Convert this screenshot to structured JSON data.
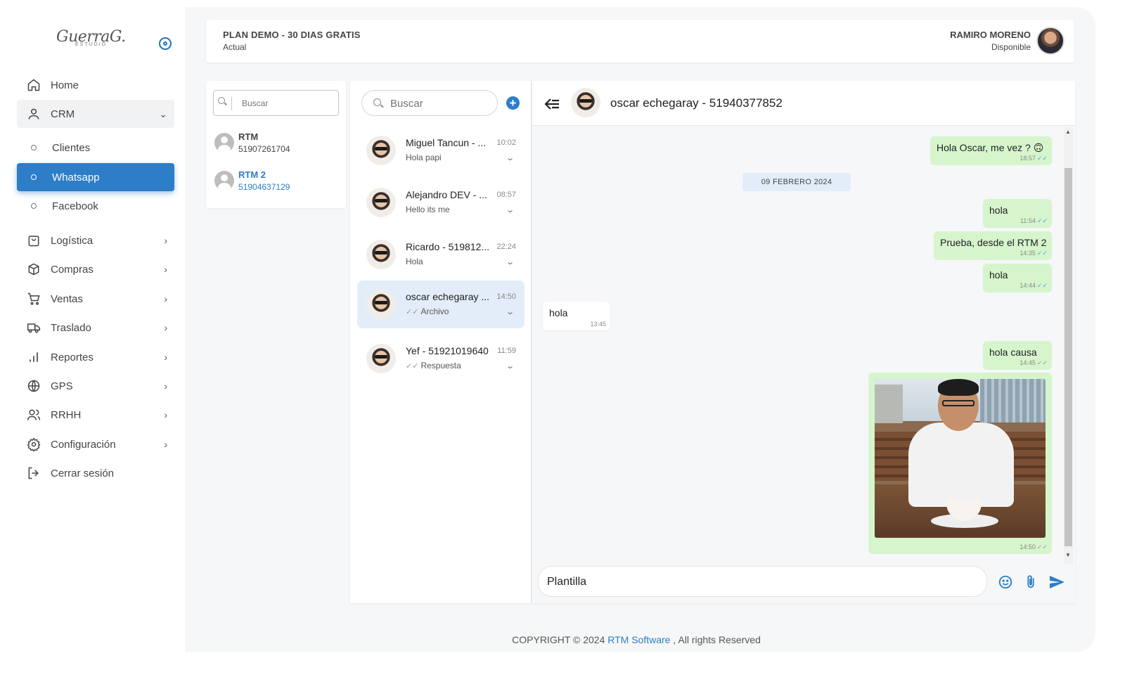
{
  "sidebar": {
    "logo_main": "GuerraG.",
    "logo_sub": "ESTUDIO",
    "items": {
      "home": "Home",
      "crm": "CRM",
      "clientes": "Clientes",
      "whatsapp": "Whatsapp",
      "facebook": "Facebook",
      "logistica": "Logística",
      "compras": "Compras",
      "ventas": "Ventas",
      "traslado": "Traslado",
      "reportes": "Reportes",
      "gps": "GPS",
      "rrhh": "RRHH",
      "configuracion": "Configuración",
      "cerrar": "Cerrar sesión"
    }
  },
  "header": {
    "plan_title": "PLAN DEMO - 30 DIAS GRATIS",
    "plan_sub": "Actual",
    "user_name": "RAMIRO MORENO",
    "user_status": "Disponible"
  },
  "accounts": {
    "search_placeholder": "Buscar",
    "items": [
      {
        "name": "RTM",
        "phone": "51907261704"
      },
      {
        "name": "RTM 2",
        "phone": "51904637129"
      }
    ]
  },
  "chatlist": {
    "search_placeholder": "Buscar",
    "chats": [
      {
        "name": "Miguel Tancun - ...",
        "time": "10:02",
        "msg": "Hola papi",
        "ticks": ""
      },
      {
        "name": "Alejandro DEV - ...",
        "time": "08:57",
        "msg": "Hello its me",
        "ticks": ""
      },
      {
        "name": "Ricardo - 519812...",
        "time": "22:24",
        "msg": "Hola",
        "ticks": ""
      },
      {
        "name": "oscar echegaray ...",
        "time": "14:50",
        "msg": "Archivo",
        "ticks": "✓✓"
      },
      {
        "name": "Yef - 51921019640",
        "time": "11:59",
        "msg": "Respuesta",
        "ticks": "✓✓"
      }
    ]
  },
  "conversation": {
    "title": "oscar echegaray - 51940377852",
    "date_chip": "09 FEBRERO 2024",
    "messages": {
      "m1": {
        "text": "Hola Oscar, me vez ? 🙃",
        "time": "18:57"
      },
      "m2": {
        "text": "hola",
        "time": "11:54"
      },
      "m3": {
        "text": "Prueba, desde el RTM 2",
        "time": "14:35"
      },
      "m4": {
        "text": "hola",
        "time": "14:44"
      },
      "m5": {
        "text": "hola",
        "time": "13:45"
      },
      "m6": {
        "text": "hola causa",
        "time": "14:45"
      },
      "m7": {
        "time": "14:50"
      }
    },
    "composer_value": "Plantilla"
  },
  "footer": {
    "prefix": "COPYRIGHT © 2024 ",
    "brand": "RTM Software",
    "suffix": " , All rights Reserved"
  },
  "colors": {
    "accent": "#2d7dc8",
    "outgoing_bubble": "#d6f5cd",
    "selected_chat": "#e3edf9"
  }
}
